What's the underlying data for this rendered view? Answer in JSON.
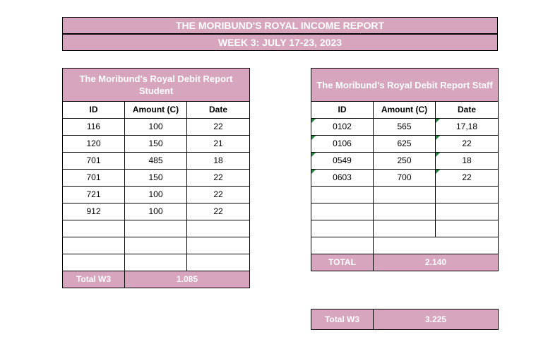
{
  "report": {
    "title": "THE MORIBUND'S ROYAL INCOME REPORT",
    "week": "WEEK 3: JULY 17-23, 2023"
  },
  "student": {
    "title": "The Moribund's Royal Debit Report Student",
    "headers": [
      "ID",
      "Amount (C)",
      "Date"
    ],
    "rows": [
      [
        "116",
        "100",
        "22"
      ],
      [
        "120",
        "150",
        "21"
      ],
      [
        "701",
        "485",
        "18"
      ],
      [
        "701",
        "150",
        "22"
      ],
      [
        "721",
        "100",
        "22"
      ],
      [
        "912",
        "100",
        "22"
      ],
      [
        "",
        "",
        ""
      ],
      [
        "",
        "",
        ""
      ],
      [
        "",
        "",
        ""
      ]
    ],
    "total_label": "Total W3",
    "total_value": "1.085"
  },
  "staff": {
    "title": "The Moribund's Royal Debit Report Staff",
    "headers": [
      "ID",
      "Amount (C)",
      "Date"
    ],
    "rows": [
      [
        "0102",
        "565",
        "17,18"
      ],
      [
        "0106",
        "625",
        "22"
      ],
      [
        "0549",
        "250",
        "18"
      ],
      [
        "0603",
        "700",
        "22"
      ],
      [
        "",
        "",
        ""
      ],
      [
        "",
        "",
        ""
      ],
      [
        "",
        "",
        ""
      ],
      [
        "",
        "",
        ""
      ]
    ],
    "last_row": [
      "",
      ""
    ],
    "total_label": "TOTAL",
    "total_value": "2.140"
  },
  "grand_total": {
    "label": "Total W3",
    "value": "3.225"
  },
  "colors": {
    "header_fill": "#d8a5bf",
    "header_text": "#ffffff",
    "cell_flag": "#1e8a3a"
  }
}
